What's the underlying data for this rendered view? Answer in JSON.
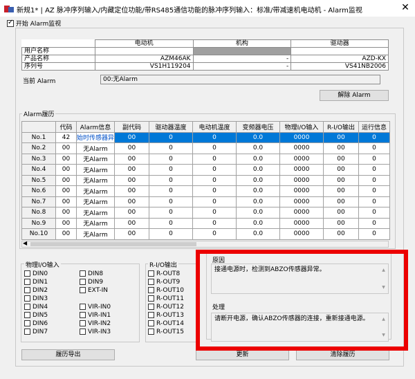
{
  "window": {
    "title": "新规1* | AZ 脉冲序列输入/内藏定位功能/带RS485通信功能的脉冲序列输入：标准/带减速机电动机 - Alarm监视",
    "close_glyph": "✕"
  },
  "monitor": {
    "label": "开始 Alarm监视",
    "checked": true
  },
  "info_table": {
    "headers": [
      "电动机",
      "机构",
      "驱动器"
    ],
    "rows": [
      {
        "label": "用户名称",
        "motor": "",
        "mechanism": "",
        "driver": ""
      },
      {
        "label": "产品名称",
        "motor": "AZM46AK",
        "mechanism": "-",
        "driver": "AZD-KX"
      },
      {
        "label": "序列号",
        "motor": "VS1H119204",
        "mechanism": "-",
        "driver": "VS41NB2006"
      }
    ]
  },
  "current_alarm": {
    "label": "当前 Alarm",
    "value": "00:无Alarm"
  },
  "reset_button": "解除 Alarm",
  "history": {
    "label": "Alarm履历",
    "headers": [
      "",
      "代码",
      "Alarm信息",
      "副代码",
      "驱动器温度",
      "电动机温度",
      "变频器电压",
      "物理I/O输入",
      "R-I/O输出",
      "运行信息"
    ],
    "rows": [
      {
        "no": "No.1",
        "code": "42",
        "info": "始时传感器异",
        "sub": "00",
        "drv_temp": "0",
        "mot_temp": "0",
        "volt": "0.0",
        "io_in": "0000",
        "rio_out": "00",
        "run": "0"
      },
      {
        "no": "No.2",
        "code": "00",
        "info": "无Alarm",
        "sub": "00",
        "drv_temp": "0",
        "mot_temp": "0",
        "volt": "0.0",
        "io_in": "0000",
        "rio_out": "00",
        "run": "0"
      },
      {
        "no": "No.3",
        "code": "00",
        "info": "无Alarm",
        "sub": "00",
        "drv_temp": "0",
        "mot_temp": "0",
        "volt": "0.0",
        "io_in": "0000",
        "rio_out": "00",
        "run": "0"
      },
      {
        "no": "No.4",
        "code": "00",
        "info": "无Alarm",
        "sub": "00",
        "drv_temp": "0",
        "mot_temp": "0",
        "volt": "0.0",
        "io_in": "0000",
        "rio_out": "00",
        "run": "0"
      },
      {
        "no": "No.5",
        "code": "00",
        "info": "无Alarm",
        "sub": "00",
        "drv_temp": "0",
        "mot_temp": "0",
        "volt": "0.0",
        "io_in": "0000",
        "rio_out": "00",
        "run": "0"
      },
      {
        "no": "No.6",
        "code": "00",
        "info": "无Alarm",
        "sub": "00",
        "drv_temp": "0",
        "mot_temp": "0",
        "volt": "0.0",
        "io_in": "0000",
        "rio_out": "00",
        "run": "0"
      },
      {
        "no": "No.7",
        "code": "00",
        "info": "无Alarm",
        "sub": "00",
        "drv_temp": "0",
        "mot_temp": "0",
        "volt": "0.0",
        "io_in": "0000",
        "rio_out": "00",
        "run": "0"
      },
      {
        "no": "No.8",
        "code": "00",
        "info": "无Alarm",
        "sub": "00",
        "drv_temp": "0",
        "mot_temp": "0",
        "volt": "0.0",
        "io_in": "0000",
        "rio_out": "00",
        "run": "0"
      },
      {
        "no": "No.9",
        "code": "00",
        "info": "无Alarm",
        "sub": "00",
        "drv_temp": "0",
        "mot_temp": "0",
        "volt": "0.0",
        "io_in": "0000",
        "rio_out": "00",
        "run": "0"
      },
      {
        "no": "No.10",
        "code": "00",
        "info": "无Alarm",
        "sub": "00",
        "drv_temp": "0",
        "mot_temp": "0",
        "volt": "0.0",
        "io_in": "0000",
        "rio_out": "00",
        "run": "0"
      }
    ]
  },
  "physical_io": {
    "label": "物理I/O输入",
    "col1": [
      "DIN0",
      "DIN1",
      "DIN2",
      "DIN3",
      "DIN4",
      "DIN5",
      "DIN6",
      "DIN7"
    ],
    "col2": [
      "DIN8",
      "DIN9",
      "EXT-IN",
      "",
      "VIR-IN0",
      "VIR-IN1",
      "VIR-IN2",
      "VIR-IN3"
    ]
  },
  "rio_out": {
    "label": "R-I/O输出",
    "items": [
      "R-OUT8",
      "R-OUT9",
      "R-OUT10",
      "R-OUT11",
      "R-OUT12",
      "R-OUT13",
      "R-OUT14",
      "R-OUT15"
    ]
  },
  "cause": {
    "label": "原因",
    "text": "接通电源时，检测到ABZO传感器异常。"
  },
  "action": {
    "label": "处理",
    "text": "请断开电源，确认ABZO传感器的连接，重新接通电源。"
  },
  "buttons": {
    "export": "履历导出",
    "update": "更新",
    "clear": "清除履历"
  },
  "colors": {
    "highlight": "#ec0000",
    "selection": "#0078d7"
  }
}
